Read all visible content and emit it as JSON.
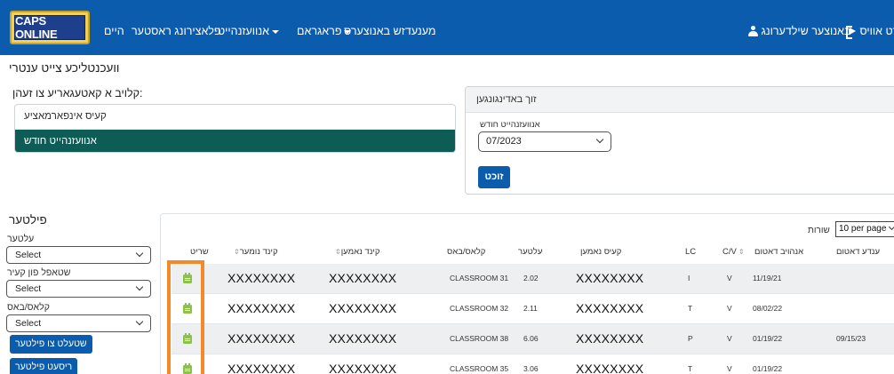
{
  "brand": {
    "logo_text": "CAPS ONLINE",
    "colors": {
      "navbar": "#0b5cad",
      "active_category": "#0d5c55",
      "button": "#0b5cad",
      "highlight": "#f28a2a",
      "calendar_icon": "#8bc34a"
    }
  },
  "nav": {
    "home": "היים",
    "provider_locator": "פלאצירונג ראסטער",
    "enrollment": "אנוועזנהייט",
    "programs": "פראגראם",
    "manage_users": "מענעדזש באנוצערס",
    "change_password": "באנוצער שילדערונג",
    "logout": "גאַרט אוויס"
  },
  "page": {
    "title": "וועכנטליכע צייט ענטרי"
  },
  "categories": {
    "label": "קלויב א קאטעגאריע צו זעהן:",
    "items": [
      {
        "label": "קעיס אינפארמאציע",
        "active": false
      },
      {
        "label": "אנוועזנהייט חודש",
        "active": true
      }
    ]
  },
  "search": {
    "header": "זוך באדינגונגען",
    "month_label": "אנוועזנהייט חודש",
    "month_value": "07/2023",
    "button": "זוכט"
  },
  "filters": {
    "title": "פילטער",
    "fields": [
      {
        "label": "עלטער",
        "value": "Select"
      },
      {
        "label": "שטאפל פון קעיר",
        "value": "Select"
      },
      {
        "label": "קלאס/באס",
        "value": "Select"
      }
    ],
    "apply_button": "שטעלט צו פילטער",
    "reset_button": "ריסעט פילטער"
  },
  "table": {
    "rows_label": "שורות",
    "rows_per_page": "10 per page",
    "headers": {
      "end_date": "ענדע דאטום",
      "start_date": "אנהויב דאטום",
      "cv": "C/V",
      "lc": "LC",
      "case_name": "קעיס נאמען",
      "age": "עלטער",
      "class": "קלאס/באס",
      "child_name": "קינד נאמען",
      "child_number": "קינד נומער",
      "action": "שריט"
    },
    "sort_glyph": "⇕",
    "rows": [
      {
        "end_date": "",
        "start_date": "11/19/21",
        "cv": "V",
        "lc": "I",
        "case_name": "XXXXXXXX",
        "age": "2.02",
        "class": "CLASSROOM 31",
        "child_name": "XXXXXXXX",
        "child_number": "XXXXXXXX",
        "action_icon": "calendar-icon"
      },
      {
        "end_date": "",
        "start_date": "08/02/22",
        "cv": "V",
        "lc": "T",
        "case_name": "XXXXXXXX",
        "age": "2.11",
        "class": "CLASSROOM 32",
        "child_name": "XXXXXXXX",
        "child_number": "XXXXXXXX",
        "action_icon": "calendar-icon"
      },
      {
        "end_date": "09/15/23",
        "start_date": "01/19/22",
        "cv": "V",
        "lc": "P",
        "case_name": "XXXXXXXX",
        "age": "6.06",
        "class": "CLASSROOM 38",
        "child_name": "XXXXXXXX",
        "child_number": "XXXXXXXX",
        "action_icon": "calendar-icon"
      },
      {
        "end_date": "",
        "start_date": "01/19/22",
        "cv": "V",
        "lc": "T",
        "case_name": "XXXXXXXX",
        "age": "3.06",
        "class": "CLASSROOM 35",
        "child_name": "XXXXXXXX",
        "child_number": "XXXXXXXX",
        "action_icon": "calendar-icon"
      }
    ]
  }
}
